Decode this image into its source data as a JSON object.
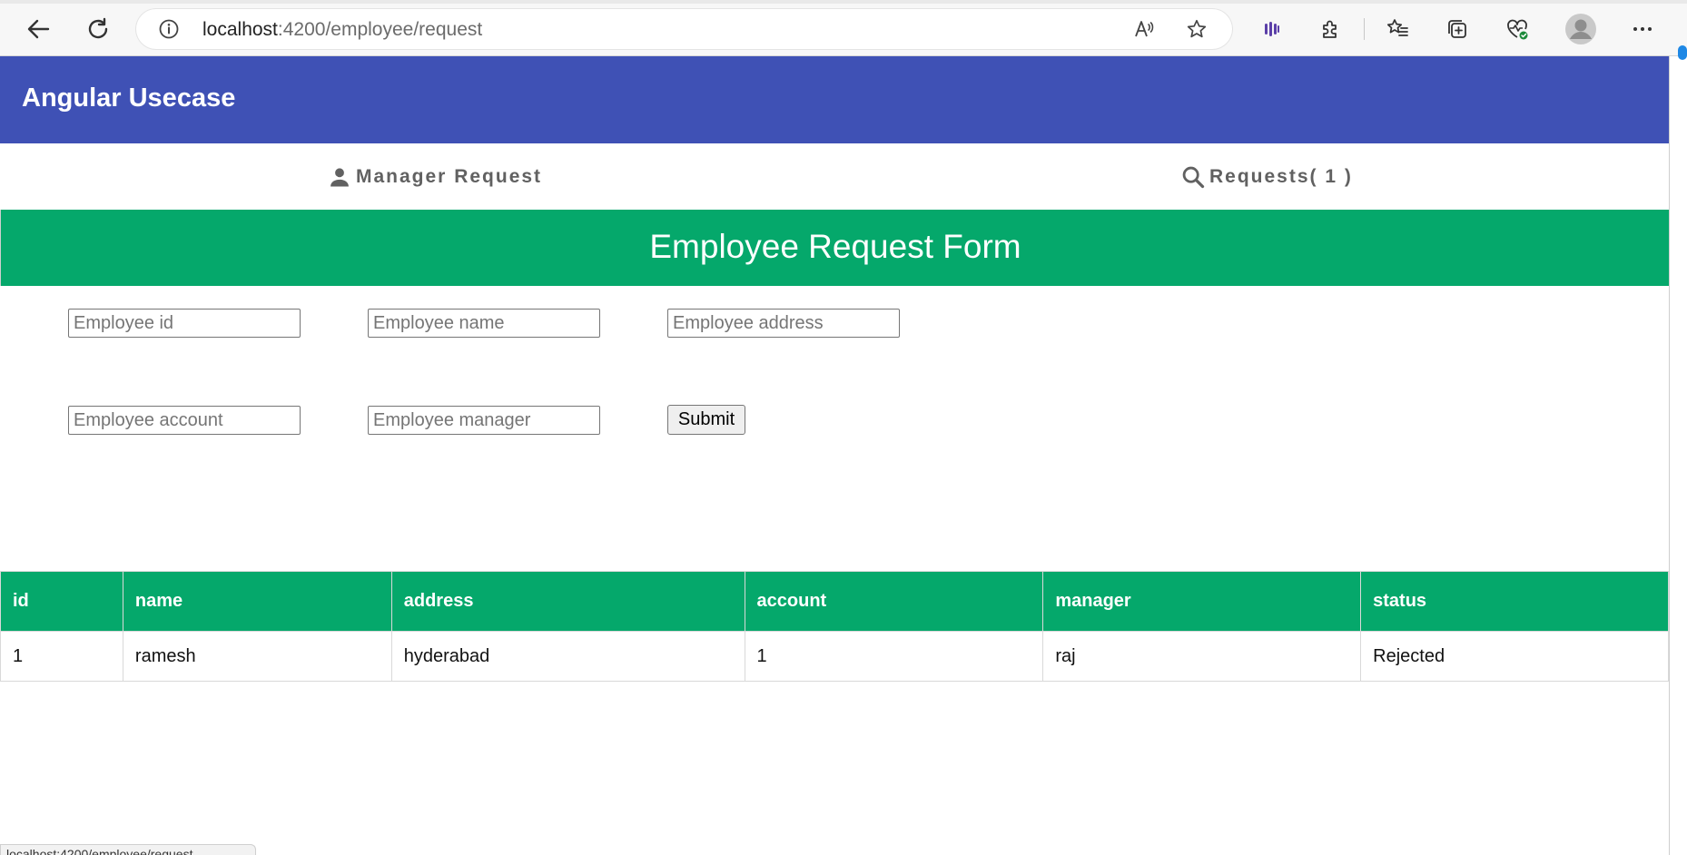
{
  "browser": {
    "url_host": "localhost",
    "url_path": ":4200/employee/request",
    "status_text": "localhost:4200/employee/request"
  },
  "app": {
    "title": "Angular Usecase"
  },
  "nav": {
    "tabs": [
      {
        "label": "Manager Request",
        "icon": "person-icon"
      },
      {
        "label": "Requests( 1 )",
        "icon": "search-icon"
      }
    ]
  },
  "form": {
    "title": "Employee Request Form",
    "fields": {
      "id_placeholder": "Employee id",
      "name_placeholder": "Employee name",
      "address_placeholder": "Employee address",
      "account_placeholder": "Employee account",
      "manager_placeholder": "Employee manager"
    },
    "submit_label": "Submit"
  },
  "table": {
    "columns": [
      "id",
      "name",
      "address",
      "account",
      "manager",
      "status"
    ],
    "rows": [
      [
        "1",
        "ramesh",
        "hyderabad",
        "1",
        "raj",
        "Rejected"
      ]
    ]
  },
  "colors": {
    "header": "#3f51b5",
    "accent": "#05a86b"
  }
}
